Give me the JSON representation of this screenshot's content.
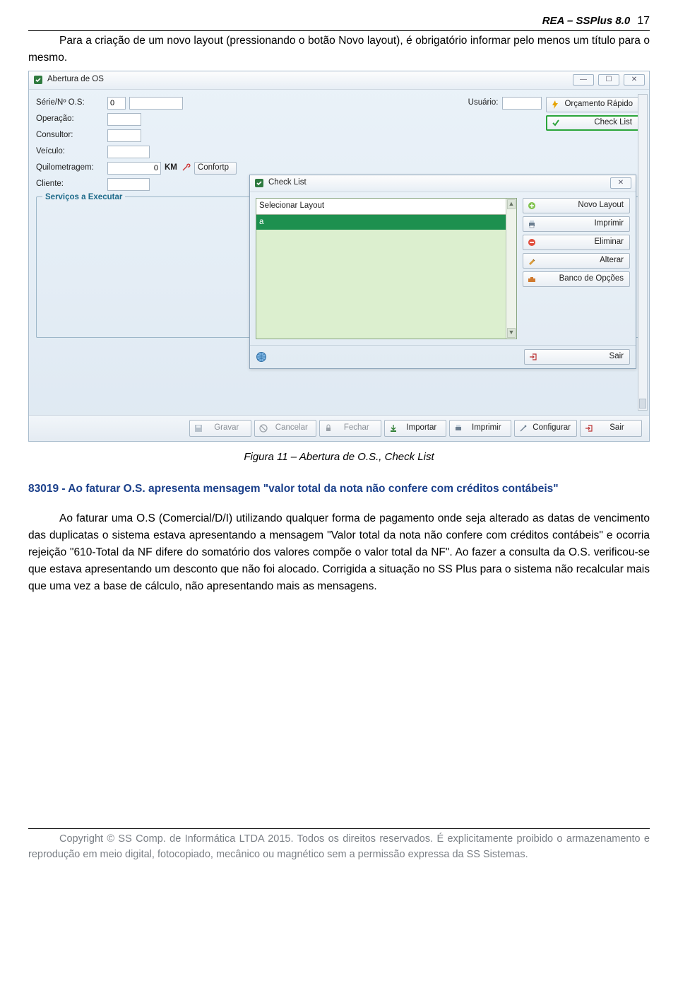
{
  "header": {
    "title": "REA – SSPlus 8.0",
    "page": "17"
  },
  "para1": "Para a criação de um novo layout (pressionando o botão Novo layout), é obrigatório informar pelo menos um título para o mesmo.",
  "figure_caption": "Figura 11 – Abertura de O.S., Check List",
  "section_heading": "83019 - Ao faturar O.S. apresenta mensagem \"valor total da nota não confere com créditos contábeis\"",
  "para2": "Ao faturar uma O.S (Comercial/D/I) utilizando qualquer forma de pagamento onde seja alterado as datas de vencimento das duplicatas o sistema estava apresentando a mensagem \"Valor total da nota não confere com créditos contábeis\" e ocorria rejeição \"610-Total da NF difere do somatório dos valores  compõe o valor total da NF\". Ao fazer a consulta da O.S. verificou-se que estava apresentando um desconto que não foi alocado. Corrigida a situação no SS Plus para o sistema não recalcular mais que uma vez a base de cálculo, não apresentando mais as mensagens.",
  "footer": "Copyright © SS Comp. de Informática LTDA 2015. Todos os direitos reservados. É explicitamente proibido o armazenamento e reprodução em meio digital, fotocopiado, mecânico ou magnético sem a permissão expressa da SS Sistemas.",
  "app": {
    "window_title": "Abertura de OS",
    "fields": {
      "serie": "Série/Nº O.S:",
      "serie_val": "0",
      "operacao": "Operação:",
      "consultor": "Consultor:",
      "veiculo": "Veículo:",
      "km": "Quilometragem:",
      "km_val": "0",
      "km_unit": "KM",
      "confort": "Confortp",
      "cliente": "Cliente:",
      "usuario": "Usuário:"
    },
    "right_buttons": {
      "orcamento": "Orçamento Rápido",
      "checklist": "Check List"
    },
    "fieldset": "Serviços a Executar",
    "bottom": {
      "gravar": "Gravar",
      "cancelar": "Cancelar",
      "fechar": "Fechar",
      "importar": "Importar",
      "imprimir": "Imprimir",
      "configurar": "Configurar",
      "sair": "Sair"
    }
  },
  "dialog": {
    "title": "Check List",
    "list_header": "Selecionar Layout",
    "selected": "a",
    "buttons": {
      "novo": "Novo Layout",
      "imprimir": "Imprimir",
      "eliminar": "Eliminar",
      "alterar": "Alterar",
      "banco": "Banco de Opções",
      "sair": "Sair"
    }
  }
}
